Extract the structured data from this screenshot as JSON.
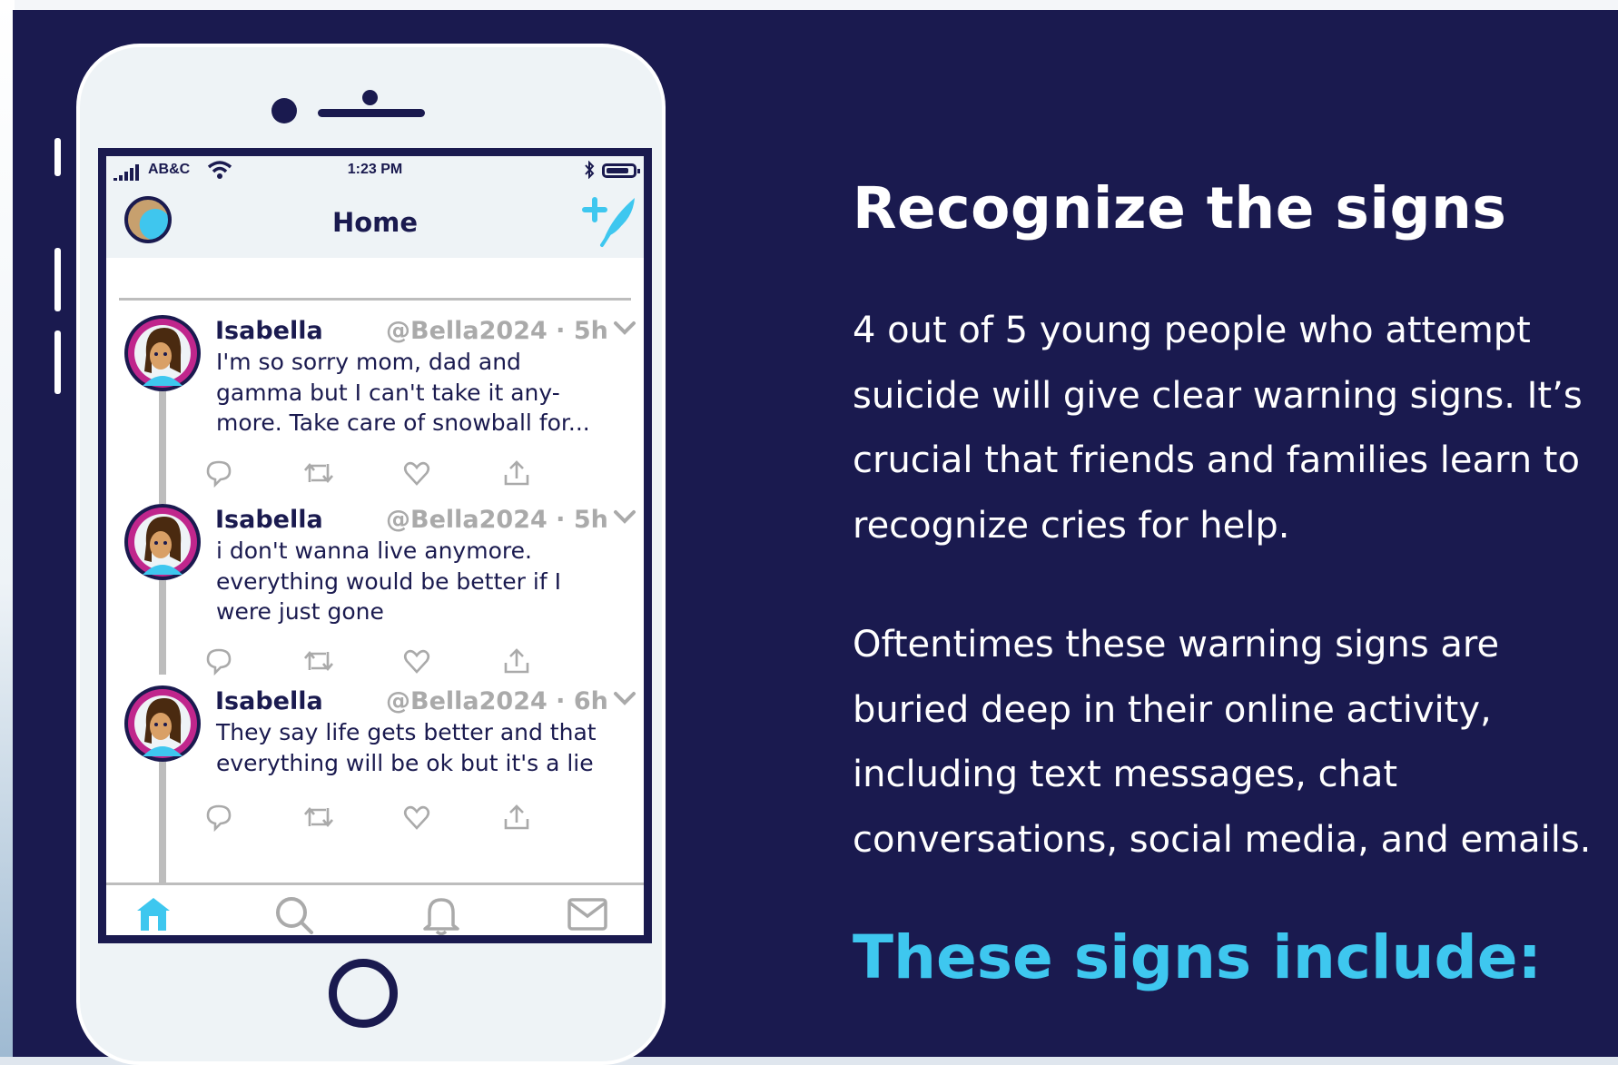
{
  "phone": {
    "status_bar": {
      "carrier": "AB&C",
      "time": "1:23 PM"
    },
    "header_title": "Home",
    "tweets": [
      {
        "name": "Isabella",
        "handle": "@Bella2024 · 5h",
        "text": "I'm so sorry mom, dad and\ngamma but I can't take it any-\nmore. Take care of snowball for..."
      },
      {
        "name": "Isabella",
        "handle": "@Bella2024 · 5h",
        "text": " i don't wanna live anymore.\neverything would be better if I\nwere just gone"
      },
      {
        "name": "Isabella",
        "handle": "@Bella2024 · 6h",
        "text": "They say life gets better and that\neverything will be ok but it's a lie"
      }
    ],
    "tabs": [
      "home-icon",
      "search-icon",
      "bell-icon",
      "mail-icon"
    ]
  },
  "content": {
    "heading": "Recognize the signs",
    "paragraph_1": "4 out of 5 young people who attempt suicide will give clear warning signs. It’s crucial that friends and families learn to recognize cries for help.",
    "paragraph_2": "Oftentimes these warning signs are buried deep in their online activity, including text messages, chat conversations, social media, and emails.",
    "subheading": "These signs include:"
  },
  "colors": {
    "background": "#1a1a4f",
    "accent": "#3ec7ef",
    "text": "#ffffff",
    "avatar_ring": "#c0268c"
  }
}
